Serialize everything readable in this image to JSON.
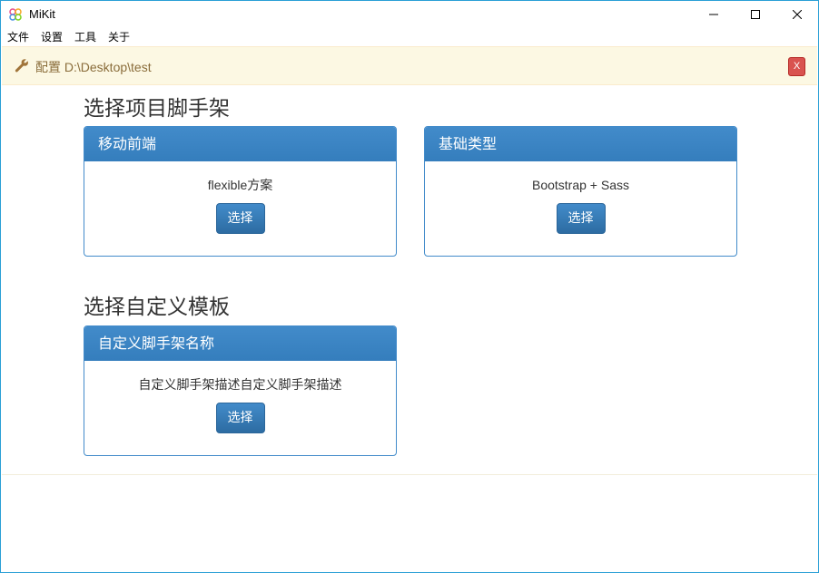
{
  "window": {
    "title": "MiKit",
    "accent_color": "#2a9fd6"
  },
  "menu": {
    "items": [
      {
        "label": "文件"
      },
      {
        "label": "设置"
      },
      {
        "label": "工具"
      },
      {
        "label": "关于"
      }
    ]
  },
  "config": {
    "label": "配置 D:\\Desktop\\test",
    "close_label": "X",
    "background": "#fcf8e3",
    "text_color": "#8a6d3b"
  },
  "sections": {
    "scaffold": {
      "title": "选择项目脚手架",
      "cards": [
        {
          "header": "移动前端",
          "description": "flexible方案",
          "button": "选择"
        },
        {
          "header": "基础类型",
          "description": "Bootstrap + Sass",
          "button": "选择"
        }
      ]
    },
    "custom": {
      "title": "选择自定义模板",
      "cards": [
        {
          "header": "自定义脚手架名称",
          "description": "自定义脚手架描述自定义脚手架描述",
          "button": "选择"
        }
      ]
    }
  },
  "colors": {
    "primary": "#428bca",
    "danger": "#d9534f"
  }
}
